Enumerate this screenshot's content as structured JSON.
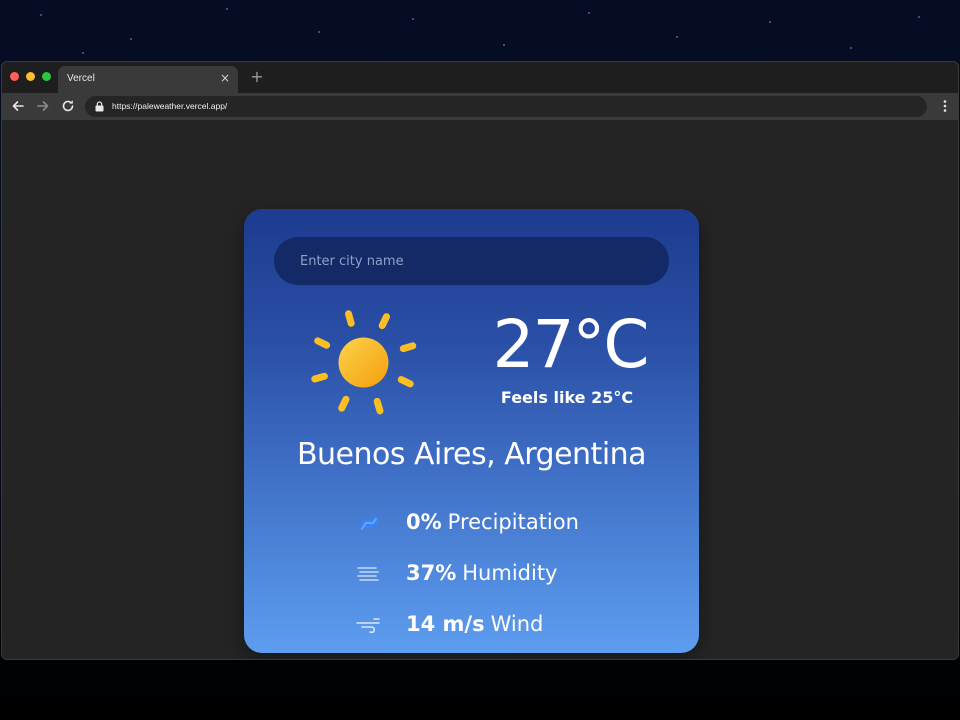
{
  "browser": {
    "tab_title": "Vercel",
    "url": "https://paleweather.vercel.app/",
    "close_glyph": "×",
    "new_tab_glyph": "+"
  },
  "weather": {
    "search_placeholder": "Enter city name",
    "temperature": "27°C",
    "feels_like": "Feels like 25°C",
    "location": "Buenos Aires, Argentina",
    "condition_icon": "sun-icon",
    "stats": [
      {
        "value": "0%",
        "label": "Precipitation",
        "icon": "precipitation-icon"
      },
      {
        "value": "37%",
        "label": "Humidity",
        "icon": "humidity-icon"
      },
      {
        "value": "14 m/s",
        "label": "Wind",
        "icon": "wind-icon"
      }
    ]
  },
  "colors": {
    "card_top": "#1d3b8f",
    "card_bottom": "#5d9def",
    "search_bg": "#132a66",
    "sun": "#fbbf24"
  }
}
